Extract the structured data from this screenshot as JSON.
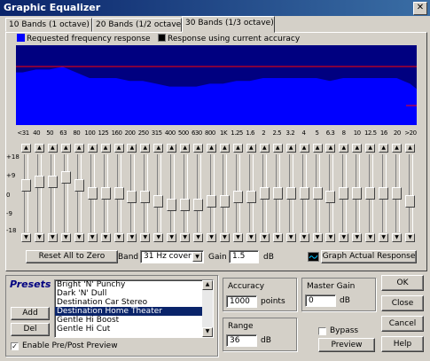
{
  "window": {
    "title": "Graphic Equalizer",
    "close_glyph": "✕"
  },
  "tabs": [
    {
      "label": "10 Bands (1 octave)",
      "active": false
    },
    {
      "label": "20 Bands (1/2 octave)",
      "active": false
    },
    {
      "label": "30 Bands (1/3 octave)",
      "active": true
    }
  ],
  "legend": {
    "requested": "Requested frequency response",
    "current": "Response using current accuracy",
    "requested_color": "#0000ff",
    "current_color": "#ff0000"
  },
  "graph": {
    "bg_color": "#000080",
    "fill_color": "#0000ff",
    "line_color": "#ff0000"
  },
  "bands": [
    {
      "label": "<31",
      "gain": 2
    },
    {
      "label": "40",
      "gain": 3
    },
    {
      "label": "50",
      "gain": 3
    },
    {
      "label": "63",
      "gain": 4
    },
    {
      "label": "80",
      "gain": 2
    },
    {
      "label": "100",
      "gain": 0
    },
    {
      "label": "125",
      "gain": 0
    },
    {
      "label": "160",
      "gain": 0
    },
    {
      "label": "200",
      "gain": -1
    },
    {
      "label": "250",
      "gain": -1
    },
    {
      "label": "315",
      "gain": -2
    },
    {
      "label": "400",
      "gain": -3
    },
    {
      "label": "500",
      "gain": -3
    },
    {
      "label": "630",
      "gain": -3
    },
    {
      "label": "800",
      "gain": -2
    },
    {
      "label": "1K",
      "gain": -2
    },
    {
      "label": "1.25",
      "gain": -1
    },
    {
      "label": "1.6",
      "gain": -1
    },
    {
      "label": "2",
      "gain": 0
    },
    {
      "label": "2.5",
      "gain": 0
    },
    {
      "label": "3.2",
      "gain": 0
    },
    {
      "label": "4",
      "gain": 0
    },
    {
      "label": "5",
      "gain": 0
    },
    {
      "label": "6.3",
      "gain": -1
    },
    {
      "label": "8",
      "gain": 0
    },
    {
      "label": "10",
      "gain": 0
    },
    {
      "label": "12.5",
      "gain": 0
    },
    {
      "label": "16",
      "gain": 0
    },
    {
      "label": "20",
      "gain": 0
    },
    {
      "label": ">20",
      "gain": -2
    }
  ],
  "scale": {
    "top": "+18",
    "upper": "+9",
    "mid": "0",
    "lower": "-9",
    "bottom": "-18"
  },
  "controls": {
    "reset_label": "Reset All to Zero",
    "band_label": "Band",
    "band_value": "31 Hz cover",
    "gain_label": "Gain",
    "gain_value": "1.5",
    "gain_unit": "dB",
    "graph_button": "Graph Actual Response"
  },
  "presets": {
    "title": "Presets",
    "items": [
      "Bright 'N' Punchy",
      "Dark 'N' Dull",
      "Destination Car Stereo",
      "Destination Home Theater",
      "Gentle Hi Boost",
      "Gentle Hi Cut"
    ],
    "selected_index": 3,
    "add_label": "Add",
    "del_label": "Del",
    "enable_label": "Enable Pre/Post Preview",
    "enable_checked": true
  },
  "accuracy": {
    "label": "Accuracy",
    "value": "1000",
    "unit": "points"
  },
  "range": {
    "label": "Range",
    "value": "36",
    "unit": "dB"
  },
  "master_gain": {
    "label": "Master Gain",
    "value": "0",
    "unit": "dB"
  },
  "bypass": {
    "label": "Bypass",
    "checked": false
  },
  "buttons": {
    "ok": "OK",
    "close": "Close",
    "cancel": "Cancel",
    "preview": "Preview",
    "help": "Help"
  }
}
